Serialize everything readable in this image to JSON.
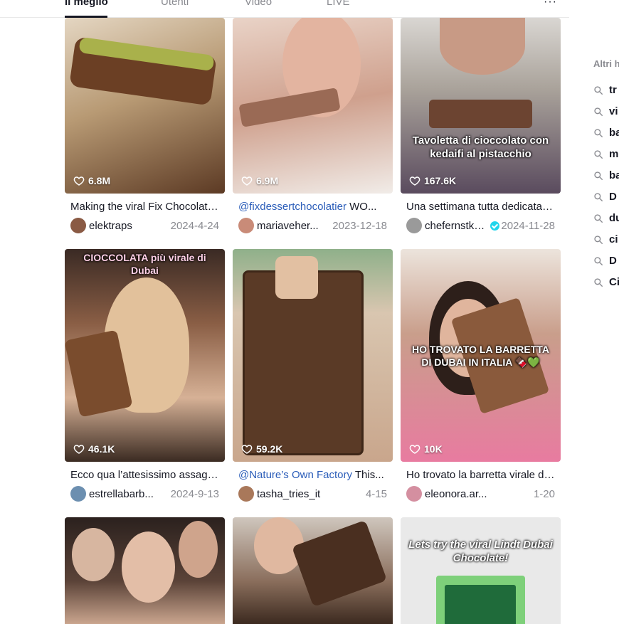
{
  "tabs": [
    {
      "label": "Il meglio",
      "active": true
    },
    {
      "label": "Utenti",
      "active": false
    },
    {
      "label": "Video",
      "active": false
    },
    {
      "label": "LIVE",
      "active": false
    }
  ],
  "more_label": "···",
  "videos": [
    {
      "likes": "6.8M",
      "caption": "Making the viral Fix Chocolate bar",
      "mention": "",
      "user": "elektraps",
      "date": "2024-4-24",
      "verified": false,
      "overlay": "",
      "bg": "#c9b59a",
      "avatar": "#8a5a44"
    },
    {
      "likes": "6.9M",
      "caption": " WO...",
      "mention": "@fixdessertchocolatier",
      "user": "mariaveher...",
      "date": "2023-12-18",
      "verified": false,
      "overlay": "",
      "bg": "#d7b5a6",
      "avatar": "#c98b78"
    },
    {
      "likes": "167.6K",
      "caption": "Una settimana tutta dedicata al cioccolato",
      "mention": "",
      "user": "chefernstkn...",
      "date": "2024-11-28",
      "verified": true,
      "overlay": "Tavoletta di cioccolato con kedaifi al pistacchio",
      "bg": "#b9b2a8",
      "avatar": "#9a9a9a"
    },
    {
      "likes": "46.1K",
      "caption": "Ecco qua l’attesissimo assaggio",
      "mention": "",
      "user": "estrellabarb...",
      "date": "2024-9-13",
      "verified": false,
      "overlay": "CIOCCOLATA più virale di Dubai",
      "bg": "#b58a62",
      "avatar": "#6c8fb0"
    },
    {
      "likes": "59.2K",
      "caption": " This...",
      "mention": "@Nature’s Own Factory",
      "user": "tasha_tries_it",
      "date": "4-15",
      "verified": false,
      "overlay": "",
      "bg": "#6a4a33",
      "avatar": "#a9785a"
    },
    {
      "likes": "10K",
      "caption": "Ho trovato la barretta virale di Dubai",
      "mention": "",
      "user": "eleonora.ar...",
      "date": "1-20",
      "verified": false,
      "overlay": "HO TROVATO LA BARRETTA DI DUBAI IN ITALIA 🍫💚",
      "bg": "#c59f8d",
      "avatar": "#d48fa0"
    },
    {
      "likes": "",
      "caption": "",
      "mention": "",
      "user": "",
      "date": "",
      "verified": false,
      "overlay": "",
      "bg": "#4e3b33",
      "avatar": "#777"
    },
    {
      "likes": "",
      "caption": "",
      "mention": "",
      "user": "",
      "date": "",
      "verified": false,
      "overlay": "",
      "bg": "#5a4536",
      "avatar": "#777"
    },
    {
      "likes": "",
      "caption": "",
      "mention": "",
      "user": "",
      "date": "",
      "verified": false,
      "overlay": "Lets try the viral Lindt Dubai Chocolate!",
      "bg": "#e4e4e4",
      "avatar": "#777"
    }
  ],
  "sidebar": {
    "title": "Altri h",
    "items": [
      "tr",
      "vi",
      "ba",
      "m",
      "ba",
      "D",
      "du",
      "ci",
      "D",
      "Ci"
    ]
  },
  "colors": {
    "text": "#161823",
    "muted": "#8a8b91",
    "mention": "#2b5db9",
    "verified": "#20d5ec"
  }
}
